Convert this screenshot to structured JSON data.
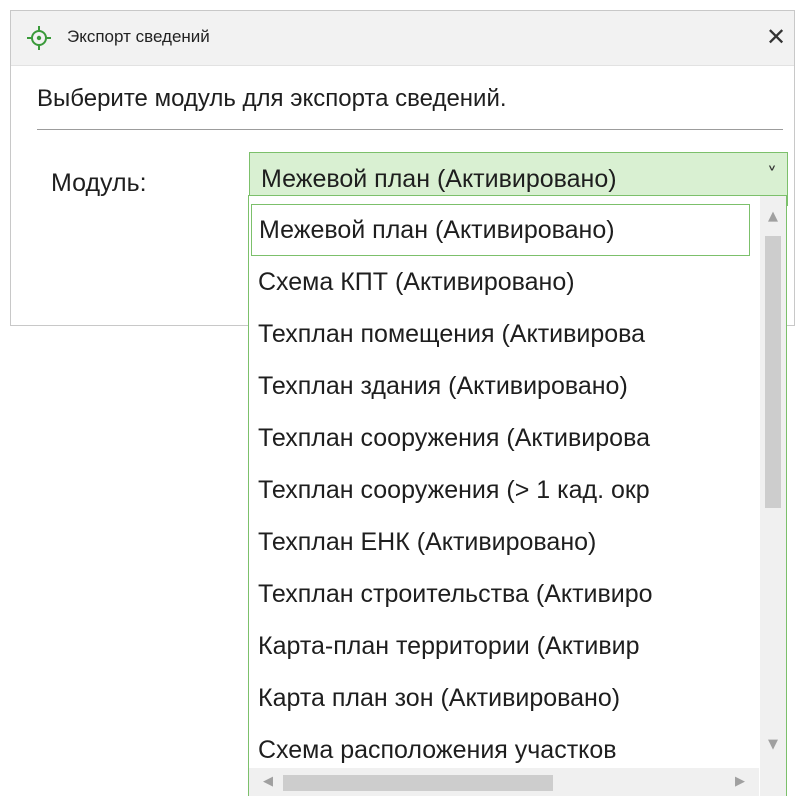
{
  "window": {
    "title": "Экспорт сведений",
    "close_symbol": "✕",
    "accent_color": "#3a9a3a"
  },
  "dialog": {
    "instruction": "Выберите модуль для экспорта сведений.",
    "module_label": "Модуль:",
    "select": {
      "value": "Межевой план (Активировано)",
      "chevron": "˅"
    }
  },
  "dropdown": {
    "items": [
      "Межевой план (Активировано)",
      "Схема КПТ (Активировано)",
      "Техплан помещения (Активирова",
      "Техплан здания (Активировано)",
      "Техплан сооружения (Активирова",
      "Техплан сооружения (> 1 кад. окр",
      "Техплан ЕНК (Активировано)",
      "Техплан строительства (Активиро",
      "Карта-план территории (Активир",
      "Карта план зон (Активировано)",
      "Схема расположения участков"
    ],
    "selected_index": 0,
    "scroll": {
      "up": "▲",
      "down": "▼",
      "left": "◀",
      "right": "▶"
    }
  },
  "icons": {
    "title": "crosshair-target-icon",
    "close": "close-icon",
    "chevron": "chevron-down-icon"
  }
}
